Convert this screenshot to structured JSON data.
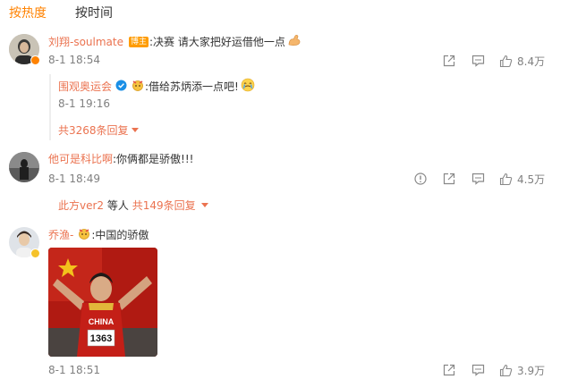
{
  "tabs": {
    "hot": "按热度",
    "time": "按时间"
  },
  "comments": [
    {
      "user": "刘翔-soulmate",
      "tag": "博主",
      "text": ":决赛 请大家把好运借他一点",
      "time": "8-1 18:54",
      "likes": "8.4万",
      "reply": {
        "user": "围观奥运会",
        "text": ":借给苏炳添一点吧!",
        "time": "8-1 19:16"
      },
      "more_replies": "共3268条回复"
    },
    {
      "user": "他可是科比啊",
      "text": ":你俩都是骄傲!!!",
      "time": "8-1 18:49",
      "likes": "4.5万",
      "reply_summary": {
        "user": "此方ver2",
        "mid": "等人",
        "count": "共149条回复"
      }
    },
    {
      "user": "乔渔-",
      "text": ":中国的骄傲",
      "time": "8-1 18:51",
      "likes": "3.9万",
      "photo": {
        "jersey_word": "CHINA",
        "bib": "1363"
      }
    }
  ],
  "colors": {
    "accent": "#ff8200",
    "username": "#eb7350",
    "meta": "#808080"
  },
  "icons": [
    "share-icon",
    "comment-icon",
    "like-icon",
    "report-icon",
    "verified-icon",
    "verified-v-icon",
    "medal-icon"
  ]
}
